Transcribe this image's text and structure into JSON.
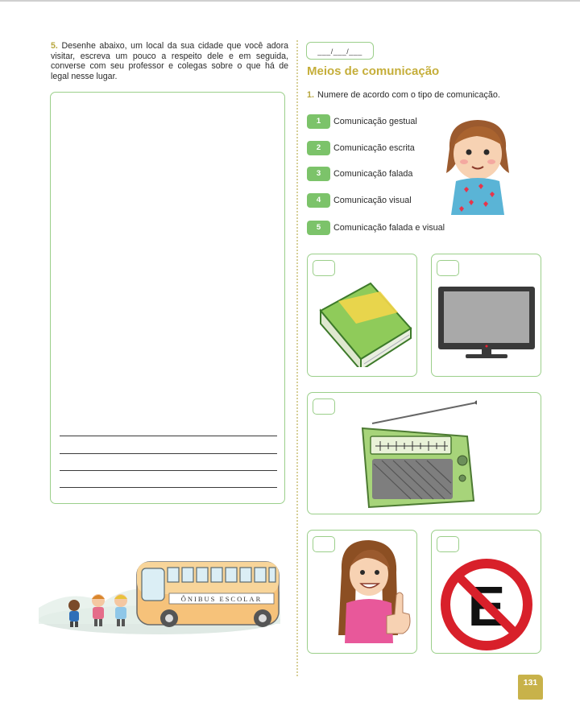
{
  "exercise5": {
    "number": "5.",
    "text": "Desenhe abaixo, um local da sua cidade que você adora visitar, escreva um pouco a respeito dele e em seguida, converse com seu professor e colegas sobre o que há de legal nesse lugar."
  },
  "date_field": "___/___/___",
  "section_title": "Meios de comunicação",
  "exercise1": {
    "number": "1.",
    "text": "Numere de acordo com o tipo de comunicação."
  },
  "communication_types": [
    {
      "num": "1",
      "label": "Comunicação gestual"
    },
    {
      "num": "2",
      "label": "Comunicação escrita"
    },
    {
      "num": "3",
      "label": "Comunicação falada"
    },
    {
      "num": "4",
      "label": "Comunicação visual"
    },
    {
      "num": "5",
      "label": "Comunicação falada e visual"
    }
  ],
  "bus_sign": "ÔNIBUS ESCOLAR",
  "sign_letter": "E",
  "page_number": "131",
  "colors": {
    "accent_green": "#7cc36a",
    "border_green": "#9bcf8a",
    "title_gold": "#c5ae3a",
    "badge_gold": "#c8b24a"
  }
}
